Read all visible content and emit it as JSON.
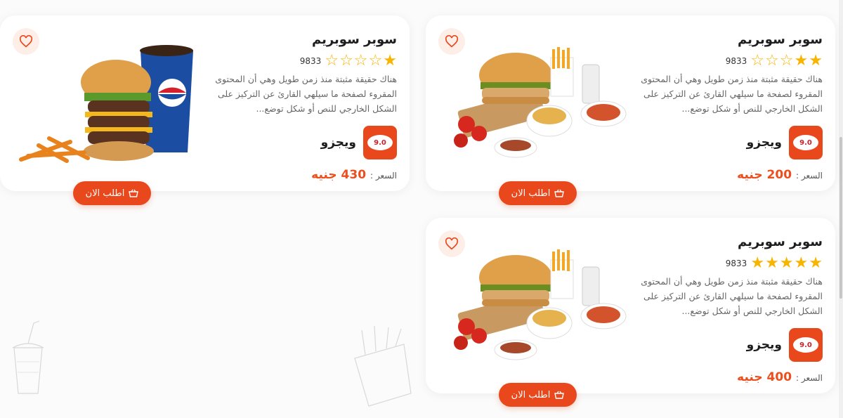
{
  "theme": {
    "accent": "#e8481c",
    "star": "#f7b500",
    "price": "#ea4f1d"
  },
  "cards": [
    {
      "title": "سوبر سوبريم",
      "rating": 2,
      "stars": [
        "on",
        "on",
        "off",
        "off",
        "off"
      ],
      "rating_count": "9833",
      "description": "هناك حقيقة مثبتة منذ زمن طويل وهي أن المحتوى المقروء لصفحة ما سيلهي القارئ عن التركيز على الشكل الخارجي للنص أو شكل توضع...",
      "vendor_name": "ويجزو",
      "vendor_logo_text": "9.0",
      "price_label": "السعر :",
      "price_value": "200 جنيه",
      "order_label": "اطلب الان",
      "favorite_icon": "heart-outline-icon"
    },
    {
      "title": "سوبر سوبريم",
      "rating": 1,
      "stars": [
        "on",
        "off",
        "off",
        "off",
        "off"
      ],
      "rating_count": "9833",
      "description": "هناك حقيقة مثبتة منذ زمن طويل وهي أن المحتوى المقروء لصفحة ما سيلهي القارئ عن التركيز على الشكل الخارجي للنص أو شكل توضع...",
      "vendor_name": "ويجزو",
      "vendor_logo_text": "9.0",
      "price_label": "السعر :",
      "price_value": "430 جنيه",
      "order_label": "اطلب الان",
      "favorite_icon": "heart-outline-icon"
    },
    {
      "title": "سوبر سوبريم",
      "rating": 5,
      "stars": [
        "on",
        "on",
        "on",
        "on",
        "on"
      ],
      "rating_count": "9833",
      "description": "هناك حقيقة مثبتة منذ زمن طويل وهي أن المحتوى المقروء لصفحة ما سيلهي القارئ عن التركيز على الشكل الخارجي للنص أو شكل توضع...",
      "vendor_name": "ويجزو",
      "vendor_logo_text": "9.0",
      "price_label": "السعر :",
      "price_value": "400 جنيه",
      "order_label": "اطلب الان",
      "favorite_icon": "heart-outline-icon"
    }
  ]
}
